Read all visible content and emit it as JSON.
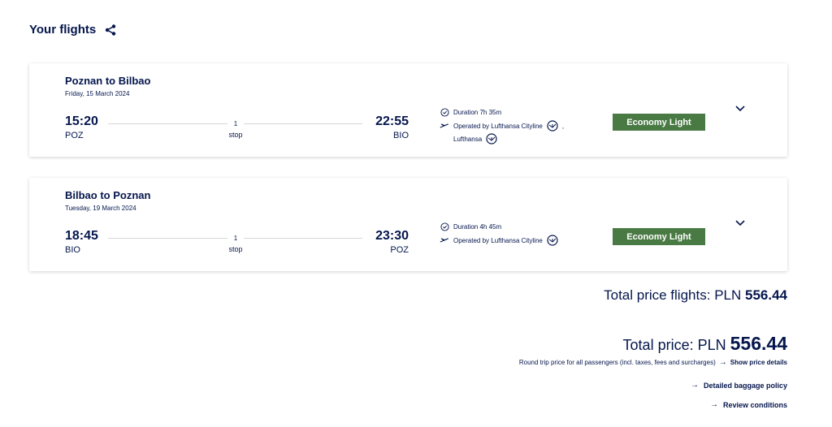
{
  "header": {
    "title": "Your flights",
    "share_icon": "share-icon"
  },
  "flights": [
    {
      "route": "Poznan to Bilbao",
      "date": "Friday, 15 March 2024",
      "dep_time": "15:20",
      "dep_code": "POZ",
      "arr_time": "22:55",
      "arr_code": "BIO",
      "stops_count": "1",
      "stops_label": "stop",
      "duration": "Duration 7h 35m",
      "operated": "Operated by Lufthansa Cityline",
      "operated_sep": ",",
      "operated_extra": "Lufthansa",
      "fare": "Economy Light"
    },
    {
      "route": "Bilbao to Poznan",
      "date": "Tuesday, 19 March 2024",
      "dep_time": "18:45",
      "dep_code": "BIO",
      "arr_time": "23:30",
      "arr_code": "POZ",
      "stops_count": "1",
      "stops_label": "stop",
      "duration": "Duration 4h 45m",
      "operated": "Operated by Lufthansa Cityline",
      "fare": "Economy Light"
    }
  ],
  "totals": {
    "flights_label": "Total price flights:",
    "flights_currency": "PLN",
    "flights_amount": "556.44",
    "total_label": "Total price:",
    "total_currency": "PLN",
    "total_amount": "556.44",
    "note": "Round trip price for all passengers (incl. taxes, fees and surcharges)",
    "price_details_link": "Show price details",
    "baggage_link": "Detailed baggage policy",
    "conditions_link": "Review conditions"
  },
  "colors": {
    "brand": "#05164d",
    "fare_badge": "#497a44"
  }
}
